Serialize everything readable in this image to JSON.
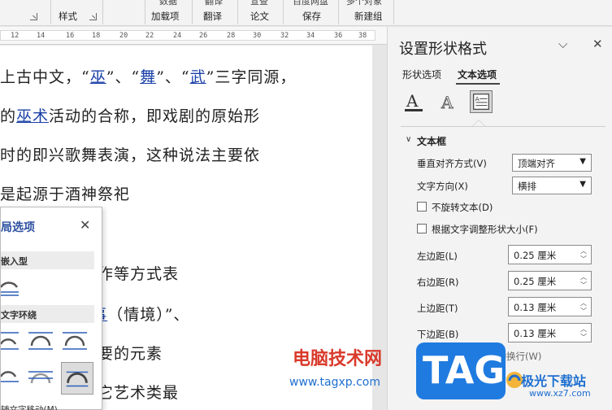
{
  "ribbon": {
    "top_partial": [
      "数据",
      "翻译",
      "宣查",
      "百度网盘",
      "多个对象"
    ],
    "groups": [
      "样式",
      "加载项",
      "翻译",
      "论文",
      "保存",
      "新建组"
    ]
  },
  "ruler": {
    "ticks": [
      "12",
      "14",
      "16",
      "18",
      "20",
      "22",
      "24",
      "26",
      "28",
      "30",
      "32",
      "34",
      "36",
      "38"
    ]
  },
  "document": {
    "lines": [
      {
        "parts": [
          {
            "t": "上古中文，“"
          },
          {
            "t": "巫",
            "link": true
          },
          {
            "t": "”、“"
          },
          {
            "t": "舞",
            "link": true
          },
          {
            "t": "”、“"
          },
          {
            "t": "武",
            "link": true
          },
          {
            "t": "”三字同源，"
          }
        ]
      },
      {
        "parts": [
          {
            "t": "的"
          },
          {
            "t": "巫术",
            "link": true
          },
          {
            "t": "活动的合称，即戏剧的原始形"
          }
        ]
      },
      {
        "parts": [
          {
            "t": "时的即兴歌舞表演，这种说法主要依"
          }
        ]
      },
      {
        "parts": [
          {
            "t": "是起源于酒神祭祀"
          }
        ]
      },
      {
        "parts": [
          {
            "t": "话、歌唱或动作等方式表"
          }
        ]
      },
      {
        "parts": [
          {
            "t": "“"
          },
          {
            "t": "演员",
            "link": true
          },
          {
            "t": "”、“"
          },
          {
            "t": "故事",
            "link": true
          },
          {
            "t": "（情境）”、"
          }
        ]
      },
      {
        "parts": [
          {
            "t": "四者当中最重要的元素"
          }
        ]
      },
      {
        "parts": [
          {
            "t": "力，戏剧与其它艺术类最"
          }
        ]
      }
    ]
  },
  "popup": {
    "title": "局选项",
    "close": "✕",
    "section_inline": "嵌入型",
    "section_wrap": "文字环绕",
    "footer": "随文字移动(M)"
  },
  "pane": {
    "title": "设置形状格式",
    "tabs": [
      "形状选项",
      "文本选项"
    ],
    "section": "文本框",
    "valign_label": "垂直对齐方式(V)",
    "valign_value": "顶端对齐",
    "direction_label": "文字方向(X)",
    "direction_value": "横排",
    "no_rotate": "不旋转文本(D)",
    "autofit": "根据文字调整形状大小(F)",
    "left_label": "左边距(L)",
    "left_value": "0.25 厘米",
    "right_label": "右边距(R)",
    "right_value": "0.25 厘米",
    "top_label": "上边距(T)",
    "top_value": "0.13 厘米",
    "bottom_label": "下边距(B)",
    "bottom_value": "0.13 厘米",
    "wrap_label": "形状中的文字自动换行(W)"
  },
  "watermark": {
    "site_text": "电脑技术网",
    "site_url": "www.tagxp.com",
    "tag": "TAG",
    "jg_text": "极光下载站",
    "jg_url": "www.xz7.com"
  }
}
